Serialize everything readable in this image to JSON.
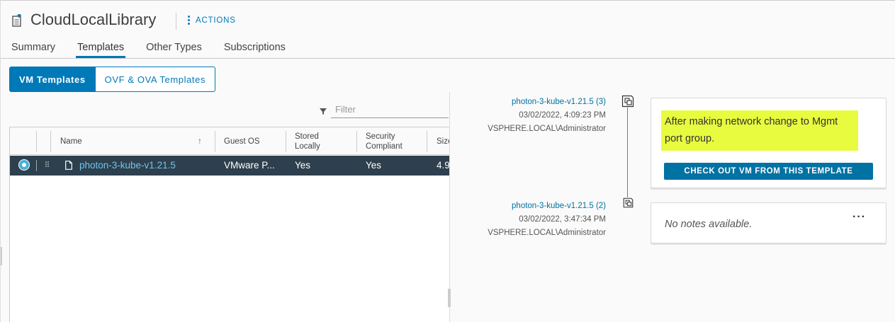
{
  "header": {
    "title": "CloudLocalLibrary",
    "actions_label": "ACTIONS"
  },
  "tabs": [
    {
      "label": "Summary",
      "active": false
    },
    {
      "label": "Templates",
      "active": true
    },
    {
      "label": "Other Types",
      "active": false
    },
    {
      "label": "Subscriptions",
      "active": false
    }
  ],
  "segmented": {
    "vm_templates": "VM Templates",
    "ovf_templates": "OVF & OVA Templates"
  },
  "filter": {
    "placeholder": "Filter"
  },
  "grid": {
    "columns": {
      "name": "Name",
      "guest_os": "Guest OS",
      "stored_locally": "Stored Locally",
      "security_compliant": "Security Compliant",
      "size": "Size"
    },
    "rows": [
      {
        "name": "photon-3-kube-v1.21.5",
        "guest_os": "VMware P...",
        "stored_locally": "Yes",
        "security_compliant": "Yes",
        "size": "4.9",
        "selected": true
      }
    ]
  },
  "versions": [
    {
      "name": "photon-3-kube-v1.21.5 (3)",
      "date": "03/02/2022, 4:09:23 PM",
      "user": "VSPHERE.LOCAL\\Administrator",
      "note": "After making network change to Mgmt port group.",
      "action_label": "CHECK OUT VM FROM THIS TEMPLATE"
    },
    {
      "name": "photon-3-kube-v1.21.5 (2)",
      "date": "03/02/2022, 3:47:34 PM",
      "user": "VSPHERE.LOCAL\\Administrator",
      "note": "No notes available.",
      "more_label": "···"
    }
  ],
  "colors": {
    "accent": "#0079b8",
    "selected_row": "#2e3f4d",
    "highlight": "#e9fb3e"
  }
}
